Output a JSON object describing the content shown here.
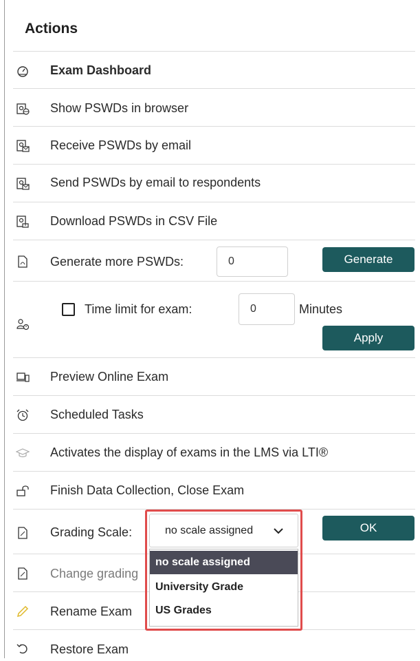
{
  "panel": {
    "title": "Actions"
  },
  "items": [
    {
      "label": "Exam Dashboard",
      "icon": "dashboard-icon"
    },
    {
      "label": "Show PSWDs in browser",
      "icon": "browser-key-icon"
    },
    {
      "label": "Receive PSWDs by email",
      "icon": "receive-mail-icon"
    },
    {
      "label": "Send PSWDs by email to respondents",
      "icon": "send-mail-icon"
    },
    {
      "label": "Download PSWDs in CSV File",
      "icon": "download-csv-icon"
    },
    {
      "label": "Generate more PSWDs:",
      "icon": "pdf-icon"
    },
    {
      "label": "Time limit for exam:",
      "icon": "user-clock-icon"
    },
    {
      "label": "Preview Online Exam",
      "icon": "preview-icon"
    },
    {
      "label": "Scheduled Tasks",
      "icon": "alarm-clock-icon"
    },
    {
      "label": "Activates the display of exams in the LMS via LTI®",
      "icon": "graduation-cap-icon"
    },
    {
      "label": "Finish Data Collection, Close Exam",
      "icon": "unlock-icon"
    },
    {
      "label": "Grading Scale:",
      "icon": "document-icon"
    },
    {
      "label": "Change grading",
      "icon": "document-icon"
    },
    {
      "label": "Rename Exam",
      "icon": "pencil-icon"
    },
    {
      "label": "Restore Exam",
      "icon": "undo-icon"
    }
  ],
  "generate": {
    "value": "0",
    "button": "Generate"
  },
  "time_limit": {
    "value": "0",
    "unit": "Minutes",
    "button": "Apply",
    "checked": false
  },
  "grading": {
    "selected": "no scale assigned",
    "button": "OK",
    "options": [
      "no scale assigned",
      "University Grade",
      "US Grades"
    ]
  },
  "colors": {
    "button_bg": "#1d5a5d",
    "highlight_border": "#e04c4c",
    "selected_option_bg": "#4a4a57"
  }
}
